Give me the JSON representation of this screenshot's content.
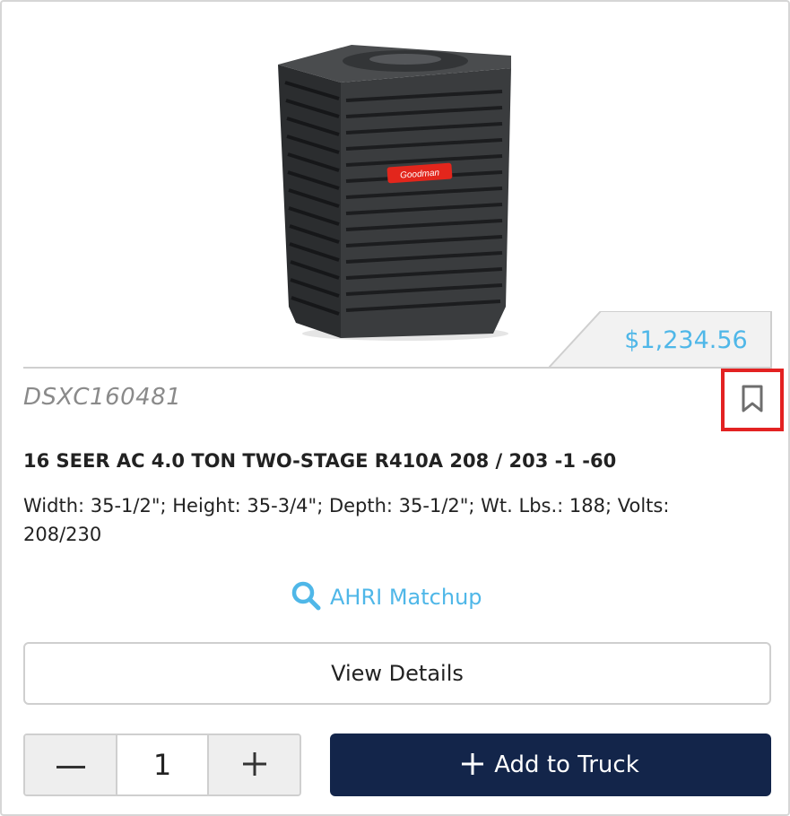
{
  "product": {
    "image_icon": "hvac-condenser-unit",
    "brand_badge": "Goodman",
    "price": "$1,234.56",
    "sku": "DSXC160481",
    "title": "16 SEER AC 4.0 TON TWO-STAGE R410A 208 / 203 -1 -60",
    "specs": "Width: 35-1/2\"; Height: 35-3/4\"; Depth: 35-1/2\"; Wt. Lbs.: 188; Volts: 208/230"
  },
  "actions": {
    "ahri_label": "AHRI Matchup",
    "ahri_icon": "search-icon",
    "view_details_label": "View Details",
    "add_to_truck_label": "Add to Truck",
    "bookmark_icon": "bookmark-icon"
  },
  "quantity": {
    "value": "1",
    "decrement_icon": "minus-icon",
    "increment_icon": "plus-icon"
  },
  "colors": {
    "accent": "#4fb7e8",
    "primary_button": "#13254a",
    "highlight_border": "#e32222",
    "badge_red": "#e3261c"
  }
}
